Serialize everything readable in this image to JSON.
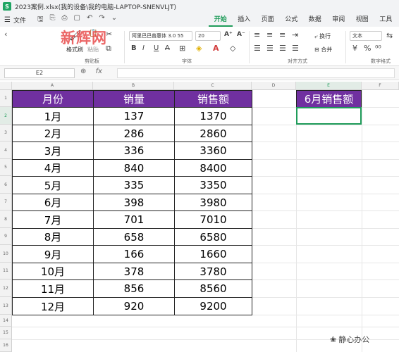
{
  "window": {
    "title": "2023案例.xlsx(我的设备\\我的电脑-LAPTOP-SNENVLJT)"
  },
  "menu": {
    "file_label": "文件"
  },
  "tabs": [
    "开始",
    "插入",
    "页面",
    "公式",
    "数据",
    "审阅",
    "视图",
    "工具"
  ],
  "active_tab": "开始",
  "ribbon": {
    "format_painter": "格式刷",
    "paste": "粘贴",
    "clipboard_group": "剪贴板",
    "font_name": "阿里巴巴普惠体 3.0 55",
    "font_size": "20",
    "font_group": "字体",
    "wrap": "换行",
    "merge": "合并",
    "align_group": "对齐方式",
    "number_format": "文本",
    "number_group": "数字格式"
  },
  "watermark_top": "新辉网",
  "formula_bar": {
    "cell_ref": "E2",
    "fx": "fx",
    "value": ""
  },
  "columns": [
    "A",
    "B",
    "C",
    "D",
    "E",
    "F"
  ],
  "rows": [
    "1",
    "2",
    "3",
    "4",
    "5",
    "6",
    "7",
    "8",
    "9",
    "10",
    "11",
    "12",
    "13",
    "14",
    "15",
    "16"
  ],
  "table": {
    "headers": [
      "月份",
      "销量",
      "销售额"
    ],
    "rows": [
      [
        "1月",
        "137",
        "1370"
      ],
      [
        "2月",
        "286",
        "2860"
      ],
      [
        "3月",
        "336",
        "3360"
      ],
      [
        "4月",
        "840",
        "8400"
      ],
      [
        "5月",
        "335",
        "3350"
      ],
      [
        "6月",
        "398",
        "3980"
      ],
      [
        "7月",
        "701",
        "7010"
      ],
      [
        "8月",
        "658",
        "6580"
      ],
      [
        "9月",
        "166",
        "1660"
      ],
      [
        "10月",
        "378",
        "3780"
      ],
      [
        "11月",
        "856",
        "8560"
      ],
      [
        "12月",
        "920",
        "9200"
      ]
    ]
  },
  "side": {
    "header": "6月销售额",
    "value": ""
  },
  "footer_watermark": "静心办公",
  "colors": {
    "header_bg": "#7030a0",
    "accent": "#1f9c5a"
  }
}
